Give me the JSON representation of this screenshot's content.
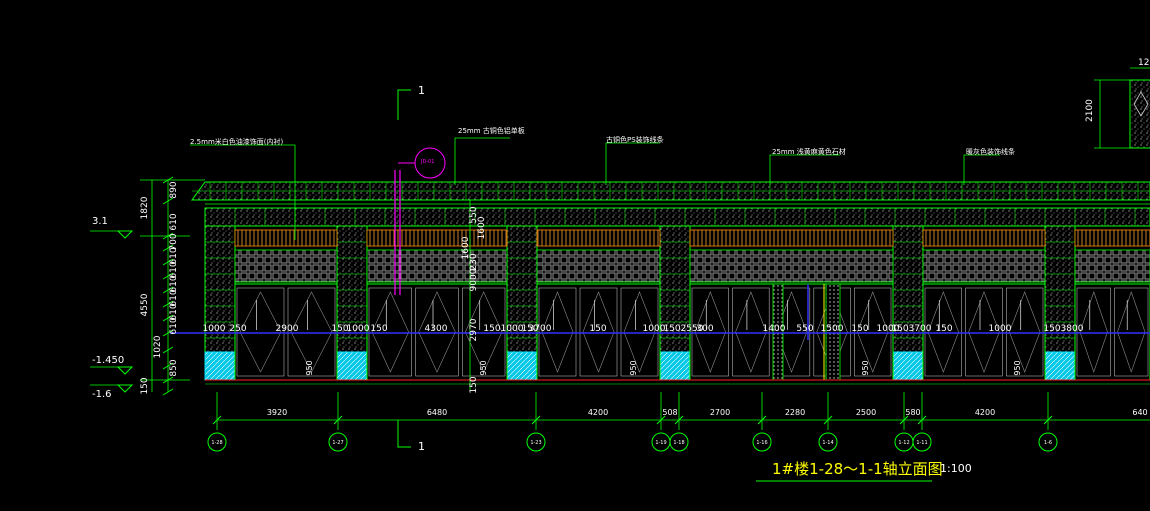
{
  "drawing": {
    "title": "1#楼1-28～1-1轴立面图",
    "scale": "1:100",
    "section_mark": "1",
    "section_mark_bottom": "1"
  },
  "annotations": [
    {
      "text": "2.5mm米白色油漆饰面(内衬)"
    },
    {
      "text": "25mm 古铜色铝单板"
    },
    {
      "text": "古铜色PS装饰线条"
    },
    {
      "text": "25mm 浅黄麻黄色石材"
    },
    {
      "text": "暖灰色装饰线条"
    }
  ],
  "circle_tag": "JD-01",
  "levels": [
    {
      "text": "3.1"
    },
    {
      "text": "-1.450"
    },
    {
      "text": "-1.6"
    }
  ],
  "left_dims": [
    "890",
    "1820",
    "610",
    "700",
    "610",
    "610",
    "610",
    "610",
    "610",
    "4550",
    "610",
    "1020",
    "850",
    "150"
  ],
  "inner_dims": [
    "550",
    "1600",
    "1600",
    "230",
    "9000",
    "2970",
    "150"
  ],
  "opening_dims": [
    "1000",
    "250",
    "2900",
    "150",
    "1000",
    "150",
    "4300",
    "150",
    "1000",
    "150",
    "3700",
    "150",
    "1000",
    "150",
    "2550",
    "300",
    "1400",
    "550",
    "1500",
    "150",
    "1000",
    "150",
    "3700",
    "150",
    "1000",
    "150",
    "3800"
  ],
  "sill_dims": [
    "950",
    "950",
    "950",
    "950",
    "950",
    "950"
  ],
  "bay_dims": [
    "3920",
    "6480",
    "4200",
    "508",
    "2700",
    "2280",
    "2500",
    "580",
    "4200",
    "640"
  ],
  "axes": [
    "1-28",
    "1-27",
    "1-23",
    "1-19",
    "1-18",
    "1-16",
    "1-14",
    "1-12",
    "1-11",
    "1-6"
  ],
  "right_detail": {
    "top": "12",
    "height": "2100"
  },
  "colors": {
    "line": "#00ff00",
    "dim": "#00ff00",
    "text": "#ffffff",
    "blue": "#3030ff",
    "cyan": "#00e5ff",
    "magenta": "#ff00ff",
    "orange": "#ff8c00",
    "red": "#ff2020",
    "accent": "#ffff00"
  }
}
